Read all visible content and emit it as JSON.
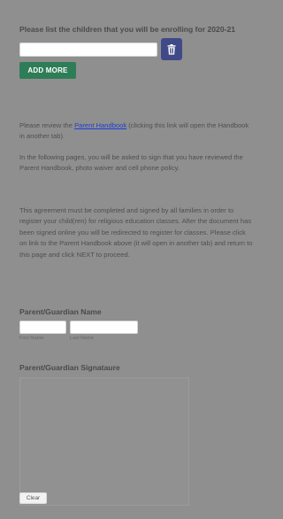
{
  "children": {
    "title": "Please list the children that you will be enrolling for 2020-21",
    "child_input_value": "",
    "delete_icon": "trash-icon",
    "add_more_label": "ADD MORE"
  },
  "info": {
    "review_prefix": "Please review the ",
    "handbook_link": "Parent Handbook",
    "review_suffix": " (clicking this link will open the Handbook in another tab).",
    "sign_text": "In the following pages, you will be asked to sign that you have reviewed the Parent Handbook, photo waiver and cell phone policy.",
    "agreement_text": "This agreement must be completed and signed by all families in order to register your child(ren) for religious education classes. After the document has been signed online you will be redirected to register for classes.  Please click on link to the Parent Handbook above (it will open in another tab) and return to this page and click NEXT to proceed."
  },
  "guardian_name": {
    "title": "Parent/Guardian Name",
    "first_name_value": "",
    "last_name_value": "",
    "first_name_label": "First Name",
    "last_name_label": "Last Name"
  },
  "signature": {
    "title": "Parent/Guardian Signataure",
    "clear_label": "Clear"
  },
  "colors": {
    "background": "#8f8f8f",
    "button_green": "#2e7d56",
    "trash_button": "#3f4a86",
    "link": "#1a3fd6"
  }
}
